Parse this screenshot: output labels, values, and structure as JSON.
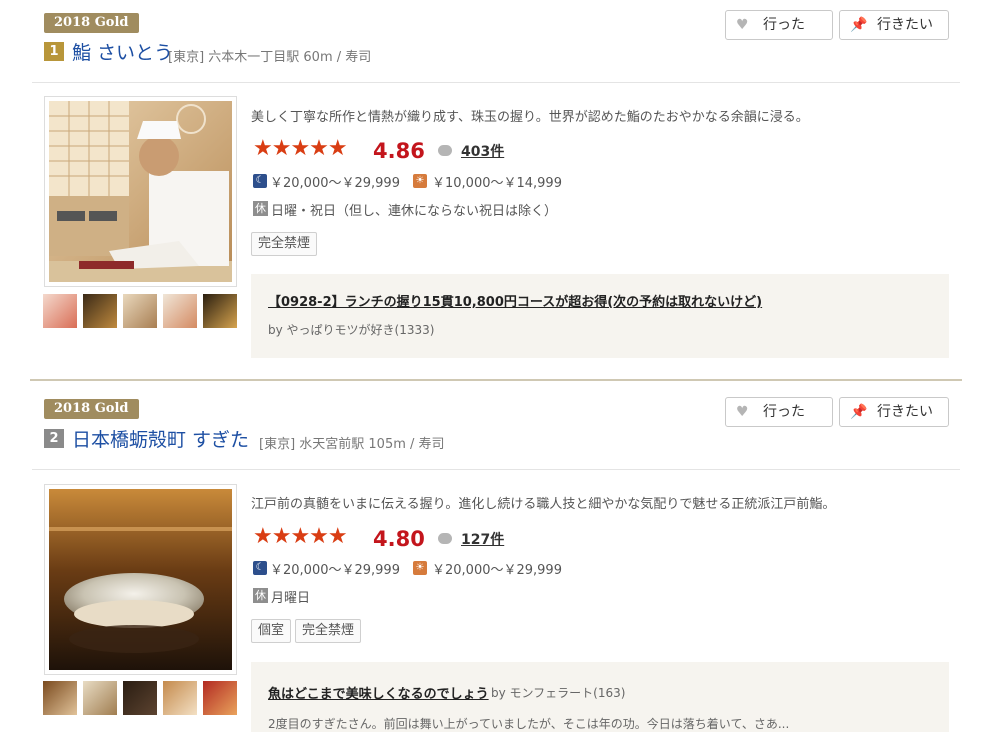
{
  "entries": [
    {
      "award": "2018 Gold",
      "rank": "1",
      "name": "鮨 さいとう",
      "meta": "[東京] 六本木一丁目駅 60m / 寿司",
      "went_label": "行った",
      "want_label": "行きたい",
      "catch": "美しく丁寧な所作と情熱が織り成す、珠玉の握り。世界が認めた鮨のたおやかなる余韻に浸る。",
      "stars": "★★★★★",
      "score": "4.86",
      "review_count": "403件",
      "dinner_price": "￥20,000～￥29,999",
      "lunch_price": "￥10,000～￥14,999",
      "holiday_icon": "休",
      "holiday": "日曜・祝日（但し、連休にならない祝日は除く）",
      "tags": [
        "完全禁煙"
      ],
      "review_title": "【0928-2】ランチの握り15貫10,800円コースが超お得(次の予約は取れないけど)",
      "review_by": "by やっぱりモツが好き(1333)",
      "review_body": ""
    },
    {
      "award": "2018 Gold",
      "rank": "2",
      "name": "日本橋蛎殻町 すぎた",
      "meta": "[東京] 水天宮前駅 105m / 寿司",
      "went_label": "行った",
      "want_label": "行きたい",
      "catch": "江戸前の真髄をいまに伝える握り。進化し続ける職人技と細やかな気配りで魅せる正統派江戸前鮨。",
      "stars": "★★★★★",
      "score": "4.80",
      "review_count": "127件",
      "dinner_price": "￥20,000～￥29,999",
      "lunch_price": "￥20,000～￥29,999",
      "holiday_icon": "休",
      "holiday": "月曜日",
      "tags": [
        "個室",
        "完全禁煙"
      ],
      "review_title": "魚はどこまで美味しくなるのでしょう",
      "review_by": "by モンフェラート(163)",
      "review_body": "2度目のすぎたさん。前回は舞い上がっていましたが、そこは年の功。今日は落ち着いて、さあ..."
    }
  ],
  "colors": {
    "link": "#1d4fa3",
    "score": "#c3151c",
    "stars": "#d93d13",
    "gold_badge": "#a08c5f"
  },
  "icons": {
    "went": "heart-icon",
    "want": "pin-icon",
    "review": "speech-bubble-icon",
    "dinner": "moon-icon",
    "lunch": "sun-icon"
  }
}
